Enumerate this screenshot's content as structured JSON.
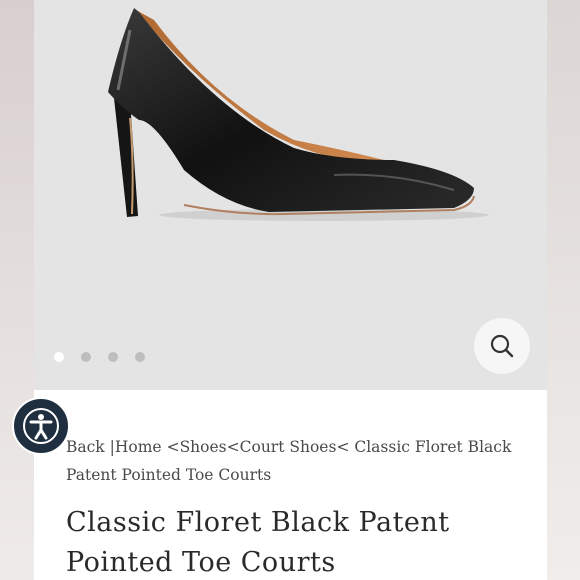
{
  "breadcrumb": {
    "back": "Back",
    "items": [
      "Home",
      "Shoes",
      "Court Shoes",
      "Classic Floret Black Patent Pointed Toe Courts"
    ]
  },
  "product": {
    "title": "Classic Floret Black Patent Pointed Toe Courts"
  },
  "gallery": {
    "image_count": 4,
    "active_index": 0
  },
  "icons": {
    "zoom": "search-icon",
    "accessibility": "accessibility-icon"
  },
  "colors": {
    "gallery_bg": "#e4e4e4",
    "accessibility_button": "#1f2f40",
    "text": "#2a2a2a"
  }
}
